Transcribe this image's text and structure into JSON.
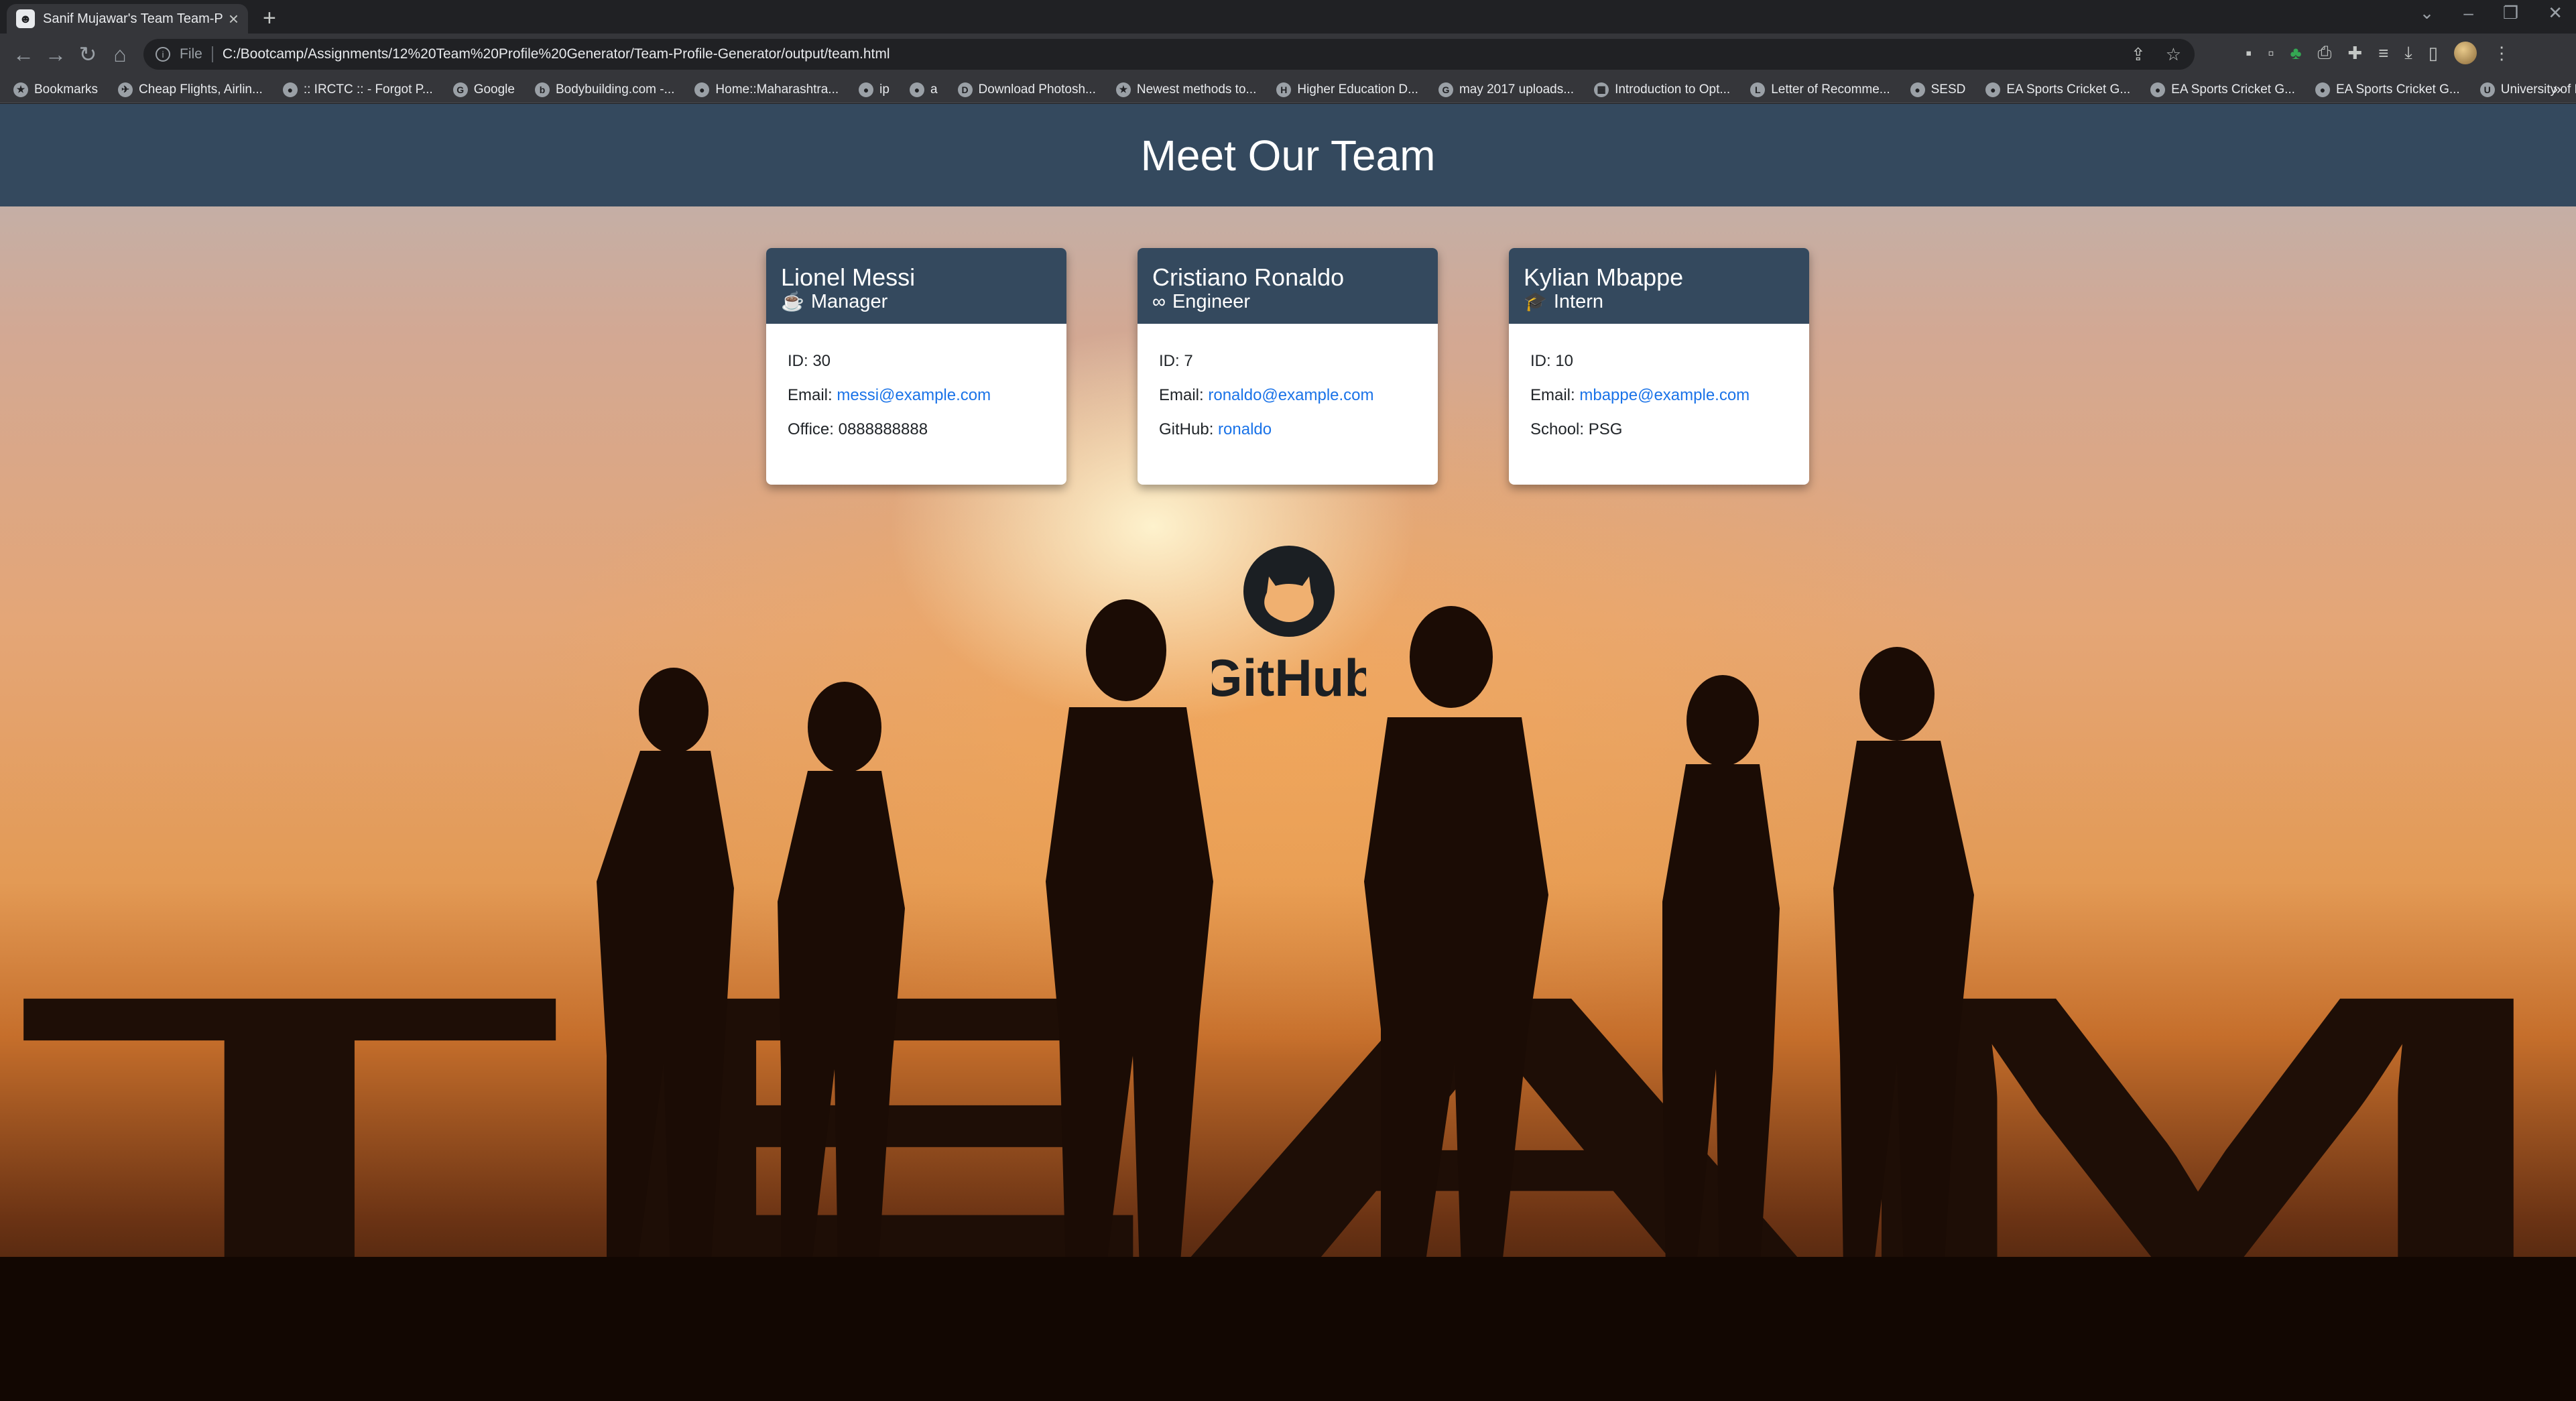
{
  "browser": {
    "tab_title": "Sanif Mujawar's Team Team-Profile",
    "url_scheme": "File",
    "url": "C:/Bootcamp/Assignments/12%20Team%20Profile%20Generator/Team-Profile-Generator/output/team.html",
    "bookmarks": [
      "Bookmarks",
      "Cheap Flights, Airlin...",
      ":: IRCTC :: - Forgot P...",
      "Google",
      "Bodybuilding.com -...",
      "Home::Maharashtra...",
      "ip",
      "a",
      "Download Photosh...",
      "Newest methods to...",
      "Higher Education D...",
      "may 2017 uploads...",
      "Introduction to Opt...",
      "Letter of Recomme...",
      "SESD",
      "EA Sports Cricket G...",
      "EA Sports Cricket G...",
      "EA Sports Cricket G...",
      "University of Birmin..."
    ]
  },
  "page": {
    "title": "Meet Our Team",
    "hero_word": "TEAM",
    "logo_text": "GitHub"
  },
  "team": [
    {
      "name": "Lionel Messi",
      "role": "Manager",
      "role_icon": "coffee-icon",
      "id_label": "ID: 30",
      "email_prefix": "Email: ",
      "email": "messi@example.com",
      "extra_prefix": "Office: ",
      "extra_value": "0888888888"
    },
    {
      "name": "Cristiano Ronaldo",
      "role": "Engineer",
      "role_icon": "glasses-icon",
      "id_label": "ID: 7",
      "email_prefix": "Email: ",
      "email": "ronaldo@example.com",
      "extra_prefix": "GitHub: ",
      "extra_value": "ronaldo"
    },
    {
      "name": "Kylian Mbappe",
      "role": "Intern",
      "role_icon": "graduate-icon",
      "id_label": "ID: 10",
      "email_prefix": "Email: ",
      "email": "mbappe@example.com",
      "extra_prefix": "School: ",
      "extra_value": "PSG"
    }
  ],
  "colors": {
    "header_bg": "#34495e",
    "link": "#1a73e8",
    "card_bg": "#ffffff"
  }
}
